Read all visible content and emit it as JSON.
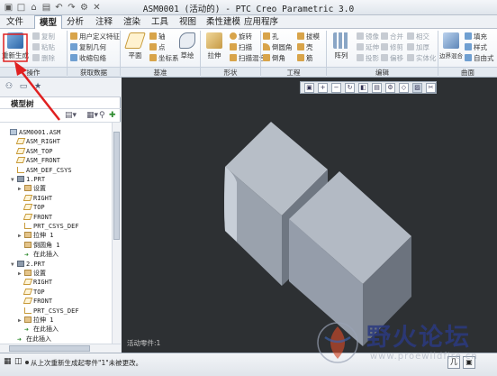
{
  "window": {
    "title": "ASM0001 (活动的) - PTC Creo Parametric 3.0"
  },
  "menu": {
    "tabs": [
      "文件",
      "模型",
      "分析",
      "注释",
      "渲染",
      "工具",
      "视图",
      "柔性建模",
      "应用程序"
    ],
    "active_tab": "模型"
  },
  "ribbon": {
    "regenerate_label": "重新生成",
    "operations_group": "操作",
    "get_data_group": "获取数据",
    "datum_group": "基准",
    "shapes_group": "形状",
    "engineering_group": "工程",
    "editing_group": "编辑",
    "surfaces_group": "曲面",
    "copy": "复制",
    "paste": "粘贴",
    "delete": "删除",
    "user_defined_feature": "用户定义特征",
    "copy_geometry": "复制几何",
    "shrinkwrap": "收缩包络",
    "axis": "轴",
    "point": "点",
    "csys": "坐标系",
    "plane": "平面",
    "sketch": "草绘",
    "extrude": "拉伸",
    "revolve": "旋转",
    "sweep": "扫描",
    "swept_blend": "扫描混合",
    "hole": "孔",
    "round": "倒圆角",
    "chamfer": "倒角",
    "draft": "拔模",
    "shell": "壳",
    "rib": "筋",
    "pattern": "阵列",
    "mirror": "镜像",
    "extend": "延伸",
    "trim": "修剪",
    "offset": "偏移",
    "merge": "合并",
    "intersect": "相交",
    "project": "投影",
    "thicken": "加厚",
    "solidify": "实体化",
    "fill": "填充",
    "style": "样式",
    "boundary_blend": "边界混合",
    "freestyle": "自由式"
  },
  "model_tree": {
    "header": "模型树",
    "rows": [
      {
        "label": "ASM0001.ASM",
        "icon": "asm",
        "indent": 0,
        "expander": ""
      },
      {
        "label": "ASM_RIGHT",
        "icon": "plane",
        "indent": 1,
        "expander": ""
      },
      {
        "label": "ASM_TOP",
        "icon": "plane",
        "indent": 1,
        "expander": ""
      },
      {
        "label": "ASM_FRONT",
        "icon": "plane",
        "indent": 1,
        "expander": ""
      },
      {
        "label": "ASM_DEF_CSYS",
        "icon": "csys",
        "indent": 1,
        "expander": ""
      },
      {
        "label": "1.PRT",
        "icon": "part",
        "indent": 1,
        "expander": "▼"
      },
      {
        "label": "设置",
        "icon": "feat",
        "indent": 2,
        "expander": "▶"
      },
      {
        "label": "RIGHT",
        "icon": "plane",
        "indent": 2,
        "expander": ""
      },
      {
        "label": "TOP",
        "icon": "plane",
        "indent": 2,
        "expander": ""
      },
      {
        "label": "FRONT",
        "icon": "plane",
        "indent": 2,
        "expander": ""
      },
      {
        "label": "PRT_CSYS_DEF",
        "icon": "csys",
        "indent": 2,
        "expander": ""
      },
      {
        "label": "拉伸 1",
        "icon": "feat",
        "indent": 2,
        "expander": "▶"
      },
      {
        "label": "倒圆角 1",
        "icon": "feat",
        "indent": 2,
        "expander": ""
      },
      {
        "label": "在此插入",
        "icon": "ins",
        "indent": 2,
        "expander": ""
      },
      {
        "label": "2.PRT",
        "icon": "part",
        "indent": 1,
        "expander": "▼"
      },
      {
        "label": "设置",
        "icon": "feat",
        "indent": 2,
        "expander": "▶"
      },
      {
        "label": "RIGHT",
        "icon": "plane",
        "indent": 2,
        "expander": ""
      },
      {
        "label": "TOP",
        "icon": "plane",
        "indent": 2,
        "expander": ""
      },
      {
        "label": "FRONT",
        "icon": "plane",
        "indent": 2,
        "expander": ""
      },
      {
        "label": "PRT_CSYS_DEF",
        "icon": "csys",
        "indent": 2,
        "expander": ""
      },
      {
        "label": "拉伸 1",
        "icon": "feat",
        "indent": 2,
        "expander": "▶"
      },
      {
        "label": "在此插入",
        "icon": "ins",
        "indent": 2,
        "expander": ""
      },
      {
        "label": "在此插入",
        "icon": "ins",
        "indent": 1,
        "expander": ""
      }
    ]
  },
  "viewport": {
    "status": "活动零件:1",
    "background": "#2d3033",
    "part_color": "#9ea6b1"
  },
  "status": {
    "message": "从上次重新生成起零件\"1\"未被更改。",
    "filter_label": "几"
  },
  "watermark": {
    "text": "野火论坛",
    "url": "www.proewildfire.cn"
  },
  "colors": {
    "arrow": "#e02020",
    "accent": "#2b579a"
  }
}
